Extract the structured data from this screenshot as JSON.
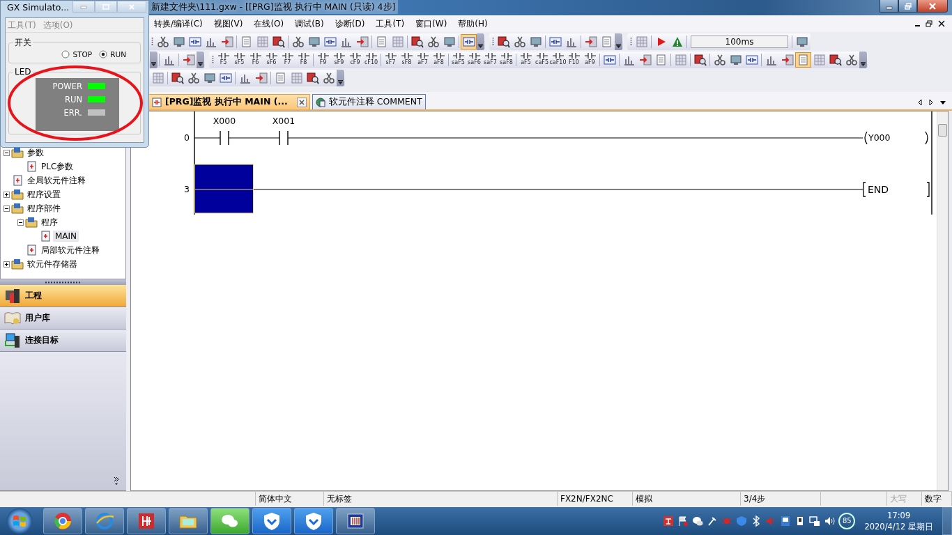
{
  "main_window": {
    "title": "新建文件夹\\111.gxw - [[PRG]监视 执行中 MAIN (只读) 4步]"
  },
  "menu": [
    "转换/编译(C)",
    "视图(V)",
    "在线(O)",
    "调试(B)",
    "诊断(D)",
    "工具(T)",
    "窗口(W)",
    "帮助(H)"
  ],
  "toolbars": [
    [
      {
        "grip": true,
        "items": [
          {
            "kind": "tool",
            "pressed": false
          },
          {
            "kind": "tool",
            "pressed": false
          },
          {
            "kind": "tool",
            "pressed": false
          },
          {
            "kind": "tool",
            "pressed": false
          },
          {
            "kind": "tool",
            "pressed": false
          },
          {
            "kind": "sep"
          },
          {
            "kind": "tool",
            "pressed": false
          },
          {
            "kind": "tool",
            "pressed": false
          },
          {
            "kind": "tool",
            "pressed": false
          },
          {
            "kind": "sep"
          },
          {
            "kind": "tool",
            "pressed": false
          },
          {
            "kind": "tool",
            "pressed": false
          },
          {
            "kind": "tool",
            "pressed": false
          },
          {
            "kind": "tool",
            "pressed": false
          },
          {
            "kind": "tool",
            "pressed": false
          },
          {
            "kind": "sep"
          },
          {
            "kind": "tool",
            "pressed": false
          },
          {
            "kind": "tool",
            "pressed": false
          },
          {
            "kind": "sep"
          },
          {
            "kind": "tool",
            "pressed": false
          },
          {
            "kind": "tool",
            "pressed": false
          },
          {
            "kind": "tool",
            "pressed": false
          },
          {
            "kind": "sep"
          },
          {
            "kind": "tool",
            "pressed": true
          },
          {
            "kind": "more"
          }
        ]
      },
      {
        "grip": true,
        "items": [
          {
            "kind": "tool",
            "pressed": false
          },
          {
            "kind": "tool",
            "pressed": false
          },
          {
            "kind": "tool",
            "pressed": false
          },
          {
            "kind": "sep"
          },
          {
            "kind": "tool",
            "pressed": false
          },
          {
            "kind": "tool",
            "pressed": false
          },
          {
            "kind": "sep"
          },
          {
            "kind": "tool",
            "pressed": false
          },
          {
            "kind": "tool",
            "pressed": false
          },
          {
            "kind": "more"
          }
        ]
      },
      {
        "grip": true,
        "items": [
          {
            "kind": "tool",
            "pressed": false
          },
          {
            "kind": "sep"
          },
          {
            "kind": "tool",
            "pressed": false
          },
          {
            "kind": "tool",
            "pressed": false
          },
          {
            "kind": "sep"
          },
          {
            "kind": "field",
            "value": "100ms"
          },
          {
            "kind": "sep"
          },
          {
            "kind": "tool",
            "pressed": false
          }
        ]
      }
    ],
    [
      {
        "grip": false,
        "items": [
          {
            "kind": "more"
          },
          {
            "kind": "sep"
          },
          {
            "kind": "tool",
            "pressed": false
          },
          {
            "kind": "sep"
          },
          {
            "kind": "tool",
            "pressed": false
          },
          {
            "kind": "more"
          }
        ]
      },
      {
        "grip": true,
        "items": [
          {
            "kind": "key",
            "label": "F5"
          },
          {
            "kind": "key",
            "label": "sF5"
          },
          {
            "kind": "key",
            "label": "F6"
          },
          {
            "kind": "key",
            "label": "sF6"
          },
          {
            "kind": "key",
            "label": "F7"
          },
          {
            "kind": "key",
            "label": "F8"
          },
          {
            "kind": "sep"
          },
          {
            "kind": "key",
            "label": "F9"
          },
          {
            "kind": "key",
            "label": "sF9"
          },
          {
            "kind": "key",
            "label": "cF9"
          },
          {
            "kind": "key",
            "label": "cF10"
          },
          {
            "kind": "sep"
          },
          {
            "kind": "key",
            "label": "sF7"
          },
          {
            "kind": "key",
            "label": "sF8"
          },
          {
            "kind": "key",
            "label": "aF7"
          },
          {
            "kind": "key",
            "label": "aF8"
          },
          {
            "kind": "sep"
          },
          {
            "kind": "key",
            "label": "saF5"
          },
          {
            "kind": "key",
            "label": "saF6"
          },
          {
            "kind": "key",
            "label": "saF7"
          },
          {
            "kind": "key",
            "label": "saF8"
          },
          {
            "kind": "sep"
          },
          {
            "kind": "key",
            "label": "aF5"
          },
          {
            "kind": "key",
            "label": "caF5"
          },
          {
            "kind": "key",
            "label": "caF10"
          },
          {
            "kind": "key",
            "label": "F10"
          },
          {
            "kind": "key",
            "label": "aF9"
          },
          {
            "kind": "sep"
          },
          {
            "kind": "tool",
            "pressed": false
          },
          {
            "kind": "sep"
          },
          {
            "kind": "tool",
            "pressed": false
          },
          {
            "kind": "tool",
            "pressed": false
          },
          {
            "kind": "tool",
            "pressed": false
          },
          {
            "kind": "sep"
          },
          {
            "kind": "tool",
            "pressed": false
          },
          {
            "kind": "sep"
          },
          {
            "kind": "tool",
            "pressed": false
          },
          {
            "kind": "sep"
          },
          {
            "kind": "tool",
            "pressed": false
          },
          {
            "kind": "tool",
            "pressed": false
          },
          {
            "kind": "tool",
            "pressed": false
          },
          {
            "kind": "sep"
          },
          {
            "kind": "tool",
            "pressed": false
          },
          {
            "kind": "tool",
            "pressed": false
          },
          {
            "kind": "tool",
            "pressed": true
          },
          {
            "kind": "tool",
            "pressed": false
          },
          {
            "kind": "tool",
            "pressed": false
          },
          {
            "kind": "tool",
            "pressed": false
          },
          {
            "kind": "more"
          }
        ]
      }
    ],
    [
      {
        "grip": false,
        "items": [
          {
            "kind": "tool",
            "pressed": false
          },
          {
            "kind": "sep"
          },
          {
            "kind": "tool",
            "pressed": false
          },
          {
            "kind": "tool",
            "pressed": false
          },
          {
            "kind": "tool",
            "pressed": false
          },
          {
            "kind": "tool",
            "pressed": false
          },
          {
            "kind": "sep"
          },
          {
            "kind": "tool",
            "pressed": false
          },
          {
            "kind": "tool",
            "pressed": false
          },
          {
            "kind": "sep"
          },
          {
            "kind": "tool",
            "pressed": false
          },
          {
            "kind": "tool",
            "pressed": false
          },
          {
            "kind": "tool",
            "pressed": false
          },
          {
            "kind": "tool",
            "pressed": false
          },
          {
            "kind": "more"
          }
        ]
      }
    ]
  ],
  "tree": [
    {
      "label": "参数",
      "selected": false,
      "expanded": true,
      "children": [
        {
          "label": "PLC参数",
          "selected": false
        }
      ]
    },
    {
      "label": "全局软元件注释",
      "selected": false
    },
    {
      "label": "程序设置",
      "selected": false,
      "expanded": false
    },
    {
      "label": "程序部件",
      "selected": false,
      "expanded": true,
      "children": [
        {
          "label": "程序",
          "selected": false,
          "expanded": true,
          "children": [
            {
              "label": "MAIN",
              "selected": true
            }
          ]
        },
        {
          "label": "局部软元件注释",
          "selected": false
        }
      ]
    },
    {
      "label": "软元件存储器",
      "selected": false,
      "expanded": false
    }
  ],
  "nav": [
    {
      "label": "工程",
      "selected": true
    },
    {
      "label": "用户库",
      "selected": false
    },
    {
      "label": "连接目标",
      "selected": false
    }
  ],
  "tabs": [
    {
      "label": "[PRG]监视 执行中 MAIN (...",
      "selected": true,
      "closable": true
    },
    {
      "label": "软元件注释 COMMENT",
      "selected": false,
      "closable": false
    }
  ],
  "ladder": {
    "rungs": [
      {
        "step": "0",
        "cursor": false,
        "contacts": [
          {
            "device": "X000"
          },
          {
            "device": "X001"
          }
        ],
        "output": {
          "kind": "coil",
          "device": "Y000"
        }
      },
      {
        "step": "3",
        "cursor": true,
        "output": {
          "kind": "instruction",
          "device": "END"
        }
      }
    ]
  },
  "status_bar": [
    {
      "text": "简体中文",
      "disabled": false
    },
    {
      "text": "无标签",
      "disabled": false
    },
    {
      "text": "FX2N/FX2NC",
      "disabled": false
    },
    {
      "text": "模拟",
      "disabled": false
    },
    {
      "text": "3/4步",
      "disabled": false
    },
    {
      "text": "大写",
      "disabled": true
    },
    {
      "text": "数字",
      "disabled": false
    }
  ],
  "simulator": {
    "title": "GX Simulato...",
    "menu": [
      "工具(T)",
      "选项(O)"
    ],
    "switch": {
      "label": "开关",
      "options": [
        {
          "label": "STOP",
          "selected": false
        },
        {
          "label": "RUN",
          "selected": true
        }
      ]
    },
    "led": {
      "label": "LED",
      "lamps": [
        {
          "label": "POWER",
          "on": true
        },
        {
          "label": "RUN",
          "on": true
        },
        {
          "label": "ERR.",
          "on": false
        }
      ]
    }
  },
  "annotation": {
    "kind": "ellipse",
    "color": "#e8141c"
  },
  "taskbar": {
    "tray_badge": "85",
    "time": "17:09",
    "date": "2020/4/12 星期日"
  }
}
